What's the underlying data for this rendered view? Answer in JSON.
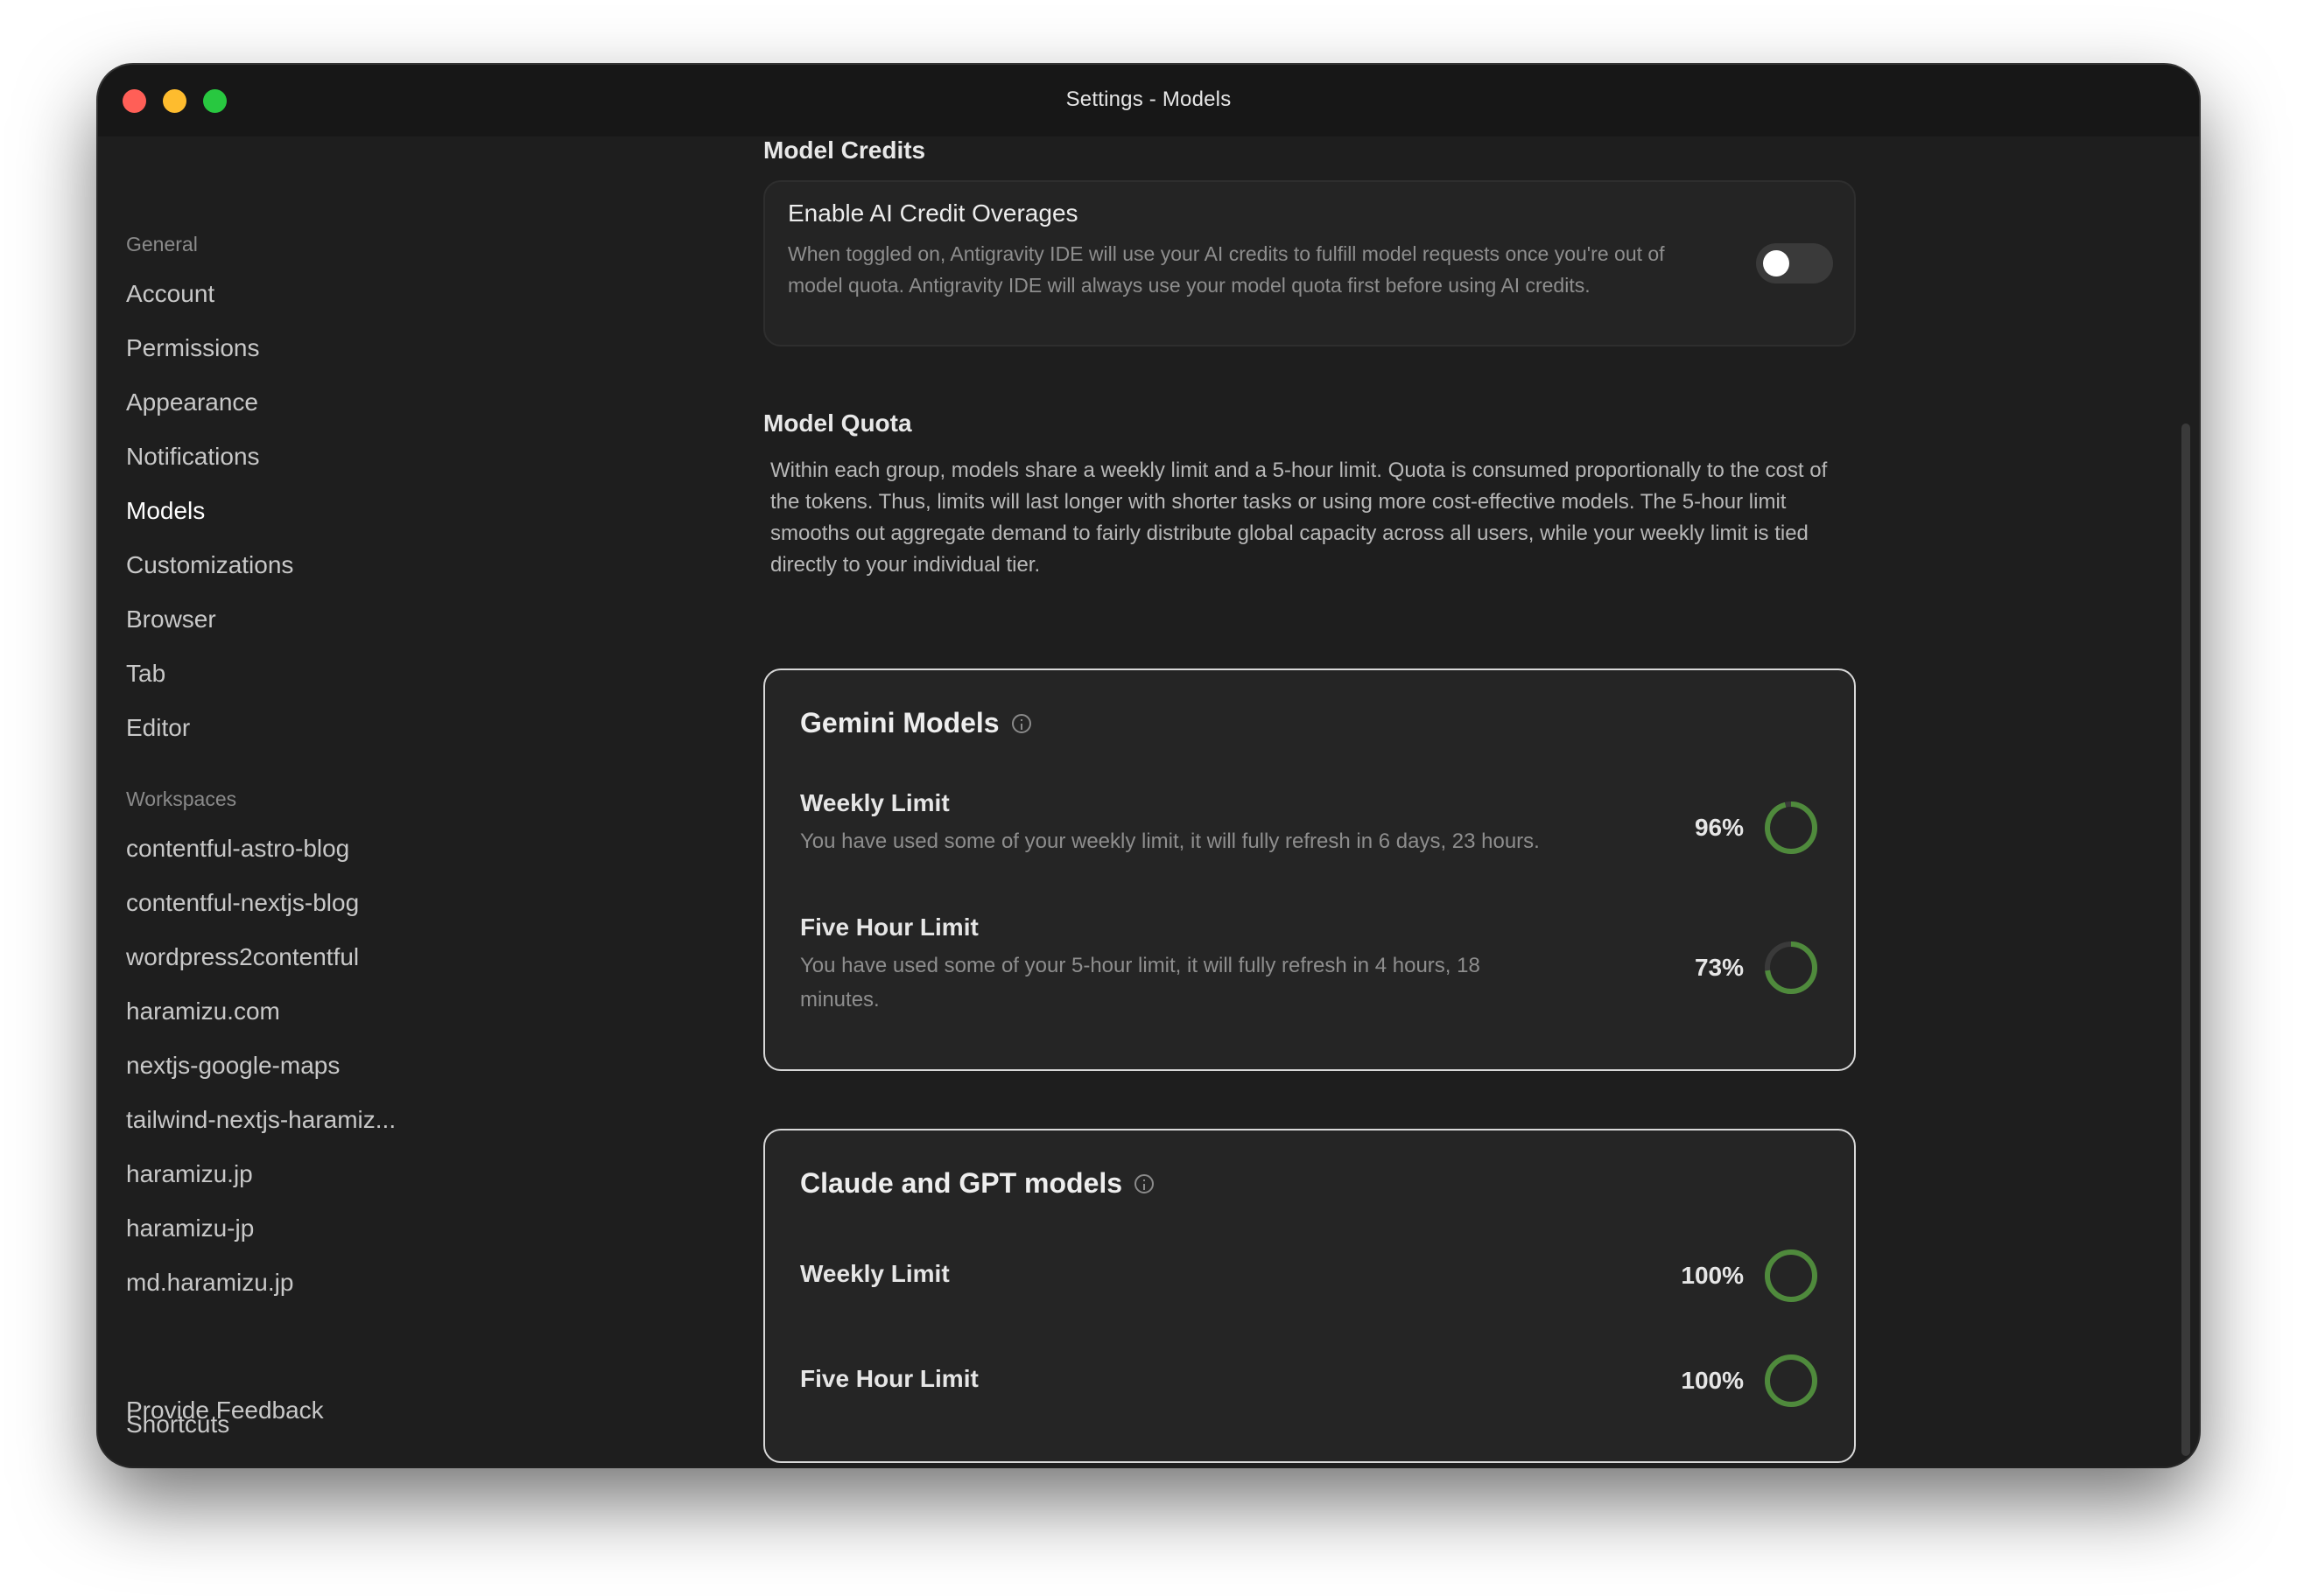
{
  "window": {
    "title": "Settings - Models"
  },
  "sidebar": {
    "general_label": "General",
    "general_items": [
      {
        "label": "Account"
      },
      {
        "label": "Permissions"
      },
      {
        "label": "Appearance"
      },
      {
        "label": "Notifications"
      },
      {
        "label": "Models",
        "active": true
      },
      {
        "label": "Customizations"
      },
      {
        "label": "Browser"
      },
      {
        "label": "Tab"
      },
      {
        "label": "Editor"
      }
    ],
    "workspaces_label": "Workspaces",
    "workspace_items": [
      {
        "label": "contentful-astro-blog"
      },
      {
        "label": "contentful-nextjs-blog"
      },
      {
        "label": "wordpress2contentful"
      },
      {
        "label": "haramizu.com"
      },
      {
        "label": "nextjs-google-maps"
      },
      {
        "label": "tailwind-nextjs-haramiz..."
      },
      {
        "label": "haramizu.jp"
      },
      {
        "label": "haramizu-jp"
      },
      {
        "label": "md.haramizu.jp"
      }
    ],
    "footer_items": [
      {
        "label": "Shortcuts"
      },
      {
        "label": "Provide Feedback"
      }
    ]
  },
  "model_credits": {
    "heading": "Model Credits",
    "card_title": "Enable AI Credit Overages",
    "card_description": "When toggled on, Antigravity IDE will use your AI credits to fulfill model requests once you're out of model quota. Antigravity IDE will always use your model quota first before using AI credits.",
    "toggle_on": false
  },
  "model_quota": {
    "heading": "Model Quota",
    "description": "Within each group, models share a weekly limit and a 5-hour limit. Quota is consumed proportionally to the cost of the tokens. Thus, limits will last longer with shorter tasks or using more cost-effective models. The 5-hour limit smooths out aggregate demand to fairly distribute global capacity across all users, while your weekly limit is tied directly to your individual tier."
  },
  "groups": [
    {
      "title": "Gemini Models",
      "limits": [
        {
          "title": "Weekly Limit",
          "description": "You have used some of your weekly limit, it will fully refresh in 6 days, 23 hours.",
          "percent_label": "96%",
          "percent": 96
        },
        {
          "title": "Five Hour Limit",
          "description": "You have used some of your 5-hour limit, it will fully refresh in 4 hours, 18 minutes.",
          "percent_label": "73%",
          "percent": 73
        }
      ]
    },
    {
      "title": "Claude and GPT models",
      "limits": [
        {
          "title": "Weekly Limit",
          "description": "",
          "percent_label": "100%",
          "percent": 100
        },
        {
          "title": "Five Hour Limit",
          "description": "",
          "percent_label": "100%",
          "percent": 100
        }
      ]
    }
  ],
  "colors": {
    "ring_fill": "#4f8a3c",
    "ring_track": "#3a3a3a"
  }
}
